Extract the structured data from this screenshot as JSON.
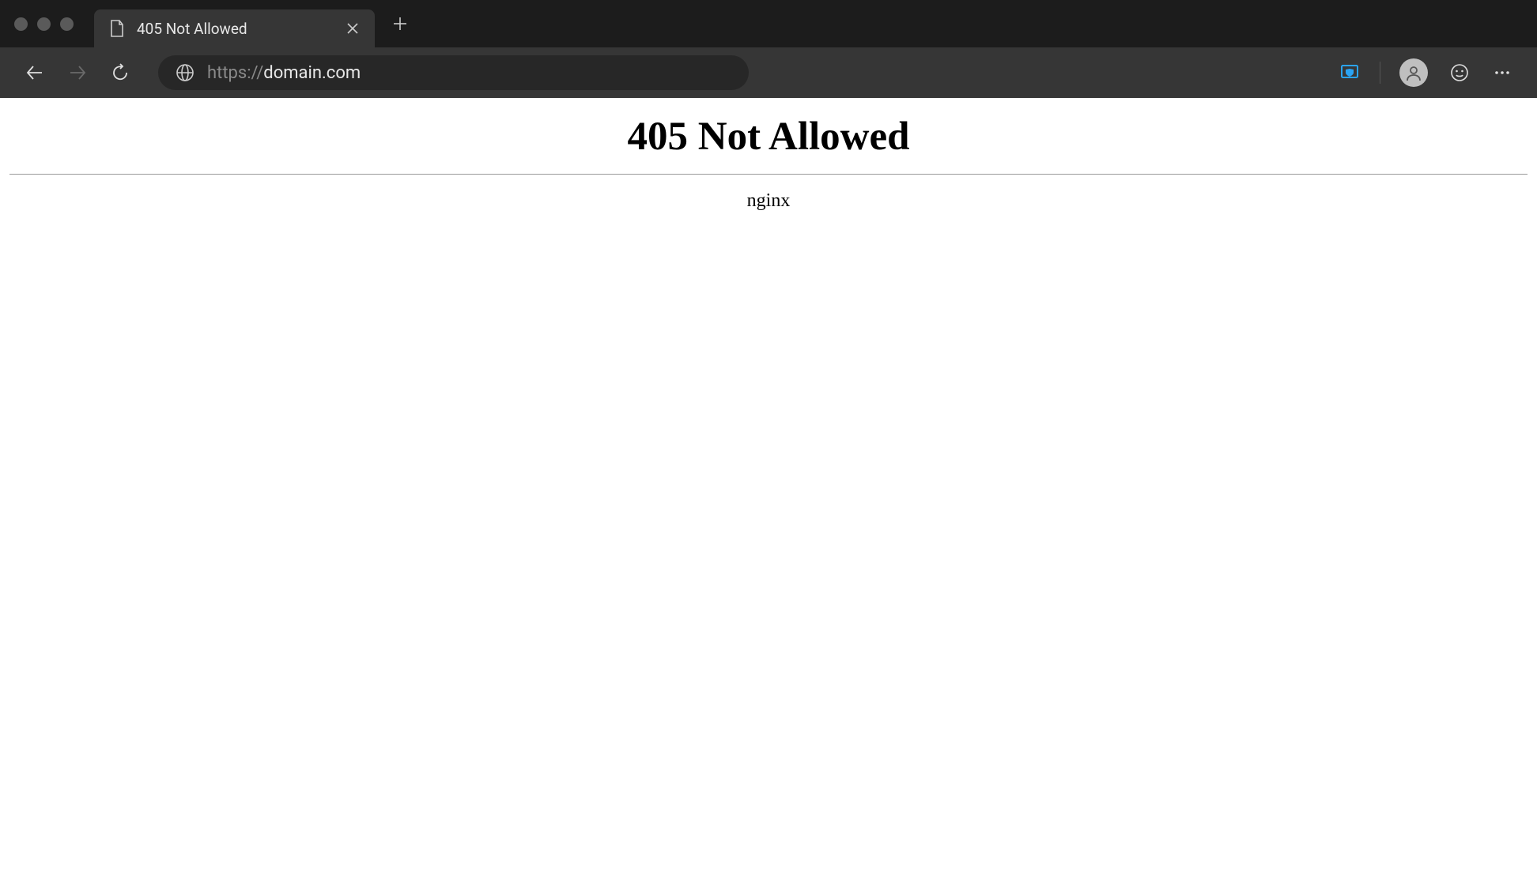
{
  "tab": {
    "title": "405 Not Allowed"
  },
  "address": {
    "scheme": "https://",
    "host": "domain.com"
  },
  "page": {
    "heading": "405 Not Allowed",
    "server": "nginx"
  }
}
